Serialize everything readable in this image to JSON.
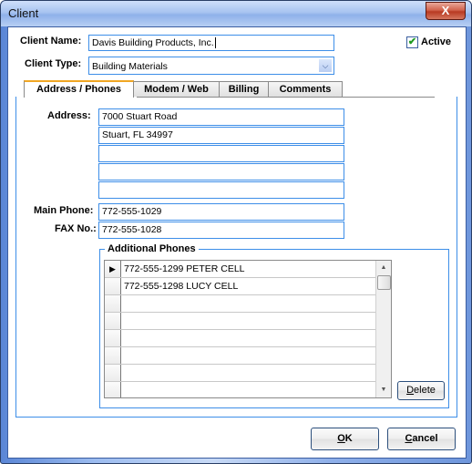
{
  "window": {
    "title": "Client",
    "close_label": "X"
  },
  "header": {
    "client_name_label": "Client Name:",
    "client_name_value": "Davis Building Products, Inc.",
    "client_type_label": "Client Type:",
    "client_type_value": "Building Materials",
    "active_label": "Active",
    "active_checked": true,
    "check_glyph": "✔"
  },
  "tabs": [
    {
      "label": "Address / Phones",
      "active": true
    },
    {
      "label": "Modem / Web",
      "active": false
    },
    {
      "label": "Billing",
      "active": false
    },
    {
      "label": "Comments",
      "active": false
    }
  ],
  "address_tab": {
    "address_label": "Address:",
    "address_lines": [
      "7000 Stuart Road",
      "Stuart, FL 34997",
      "",
      "",
      ""
    ],
    "main_phone_label": "Main Phone:",
    "main_phone_value": "772-555-1029",
    "fax_label": "FAX No.:",
    "fax_value": "772-555-1028",
    "additional_phones": {
      "title": "Additional Phones",
      "rows": [
        "772-555-1299 PETER CELL",
        "772-555-1298 LUCY CELL",
        "",
        "",
        "",
        "",
        "",
        ""
      ],
      "current_row_indicator": "▶",
      "delete_label_u": "D",
      "delete_label_rest": "elete"
    }
  },
  "footer": {
    "ok_label_u": "O",
    "ok_label_rest": "K",
    "cancel_label_u": "C",
    "cancel_label_rest": "ancel"
  },
  "colors": {
    "accent_border": "#3d8ee8",
    "active_tab_top": "#f0a623",
    "check_green": "#1e9a1e"
  }
}
